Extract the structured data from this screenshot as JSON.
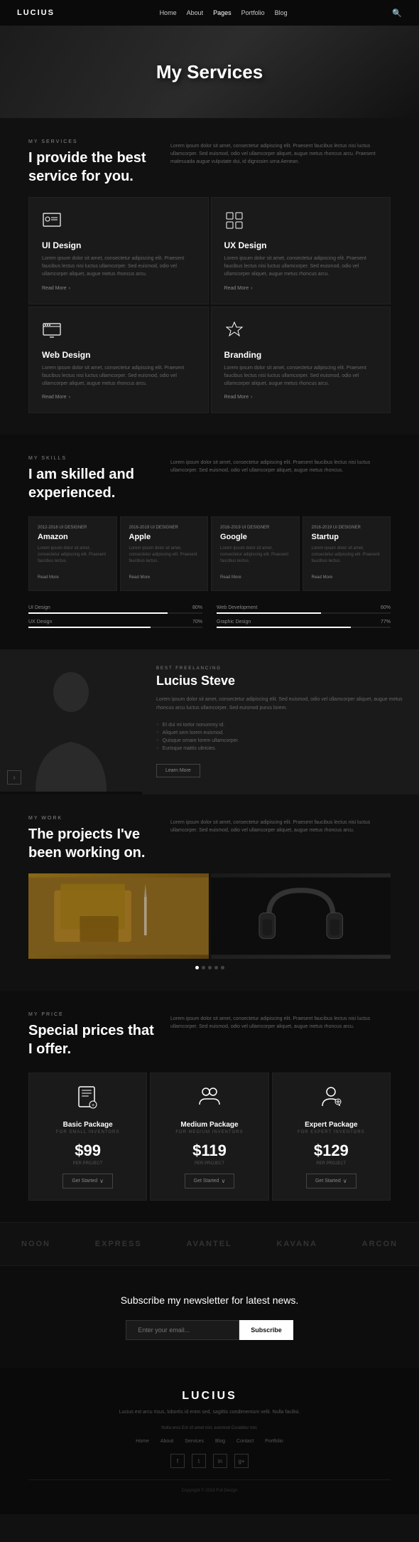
{
  "nav": {
    "logo": "LUCIUS",
    "links": [
      {
        "label": "Home",
        "active": false
      },
      {
        "label": "About",
        "active": false
      },
      {
        "label": "Pages",
        "active": true
      },
      {
        "label": "Portfolio",
        "active": false
      },
      {
        "label": "Blog",
        "active": false
      }
    ]
  },
  "hero": {
    "title": "My Services"
  },
  "services": {
    "section_label": "MY SERVICES",
    "heading": "I provide the best service for you.",
    "description": "Lorem ipsum dolor sit amet, consectetur adipiscing elit. Praesent faucibus lectus nisi luctus ullamcorper. Sed euismod, odio vel ullamcorper aliquet, augue metus rhoncus arcu. Praesent malesuada augue vulputate dui, id dignissim urna Aenean.",
    "cards": [
      {
        "icon": "🔍",
        "title": "UI Design",
        "description": "Lorem ipsum dolor sit amet, consectetur adipiscing elit. Praesent faucibus lectus nisi luctus ullamcorper. Sed euismod, odio vel ullamcorper aliquet, augue metus rhoncus arcu.",
        "link": "Read More"
      },
      {
        "icon": "⊞",
        "title": "UX Design",
        "description": "Lorem ipsum dolor sit amet, consectetur adipiscing elit. Praesent faucibus lectus nisi luctus ullamcorper. Sed euismod, odio vel ullamcorper aliquet, augue metus rhoncus arcu.",
        "link": "Read More"
      },
      {
        "icon": "🖥",
        "title": "Web Design",
        "description": "Lorem ipsum dolor sit amet, consectetur adipiscing elit. Praesent faucibus lectus nisi luctus ullamcorper. Sed euismod, odio vel ullamcorper aliquet, augue metus rhoncus arcu.",
        "link": "Read More"
      },
      {
        "icon": "🏷",
        "title": "Branding",
        "description": "Lorem ipsum dolor sit amet, consectetur adipiscing elit. Praesent faucibus lectus nisi luctus ullamcorper. Sed euismod, odio vel ullamcorper aliquet, augue metus rhoncus arcu.",
        "link": "Read More"
      }
    ]
  },
  "skills": {
    "section_label": "MY SKILLS",
    "heading": "I am skilled and experienced.",
    "description": "Lorem ipsum dolor sit amet, consectetur adipiscing elit. Praesent faucibus lectus nisi luctus ullamcorper. Sed euismod, odio vel ullamcorper aliquet, augue metus rhoncus.",
    "experience_cards": [
      {
        "years": "2012-2016 UI DESIGNER",
        "company": "Amazon",
        "description": "Lorem ipsum dolor sit amet, consectetur adipiscing elit. Praesent faucibus lectus.",
        "link": "Read More"
      },
      {
        "years": "2016-2019 UI DESIGNER",
        "company": "Apple",
        "description": "Lorem ipsum dolor sit amet, consectetur adipiscing elit. Praesent faucibus lectus.",
        "link": "Read More"
      },
      {
        "years": "2016-2019 UI DESIGNER",
        "company": "Google",
        "description": "Lorem ipsum dolor sit amet, consectetur adipiscing elit. Praesent faucibus lectus.",
        "link": "Read More"
      },
      {
        "years": "2016-2019 UI DESIGNER",
        "company": "Startup",
        "description": "Lorem ipsum dolor sit amet, consectetur adipiscing elit. Praesent faucibus lectus.",
        "link": "Read More"
      }
    ],
    "skill_bars": [
      {
        "name": "UI Design",
        "percentage": 80
      },
      {
        "name": "Web Development",
        "percentage": 60
      },
      {
        "name": "UX Design",
        "percentage": 70
      },
      {
        "name": "Graphic Design",
        "percentage": 77
      }
    ]
  },
  "freelancer": {
    "label": "BEST FREELANCING",
    "name": "Lucius Steve",
    "description": "Lorem ipsum dolor sit amet, consectetur adipiscing elit. Sed euismod, odio vel ullamcorper aliquet, augue metus rhoncus arcu luctus ullamcorper. Sed euismod purus lorem.",
    "list": [
      "Et dui mi tortor nonummy id.",
      "Aliquet sem lorem euismod.",
      "Quisque ornare lorem ullamcorper.",
      "Eurisque mattis ultricies."
    ],
    "learn_more": "Learn More"
  },
  "work": {
    "section_label": "MY WORK",
    "heading": "The projects I've been working on.",
    "description": "Lorem ipsum dolor sit amet, consectetur adipiscing elit. Praesent faucibus lectus nisi luctus ullamcorper. Sed euismod, odio vel ullamcorper aliquet, augue metus rhoncus arcu.",
    "portfolio_items": [
      {
        "label": "Wallet"
      },
      {
        "label": "Headphones"
      }
    ]
  },
  "pricing": {
    "section_label": "MY PRICE",
    "heading": "Special prices that I offer.",
    "description": "Lorem ipsum dolor sit amet, consectetur adipiscing elit. Praesent faucibus lectus nisi luctus ullamcorper. Sed euismod, odio vel ullamcorper aliquet, augue metus rhoncus arcu.",
    "plans": [
      {
        "icon": "📄",
        "name": "Basic Package",
        "sub": "For Small Inventors",
        "price": "$99",
        "period": "Per Project",
        "button": "Get Started"
      },
      {
        "icon": "👥",
        "name": "Medium Package",
        "sub": "For Medium Inventors",
        "price": "$119",
        "period": "Per Project",
        "button": "Get Started"
      },
      {
        "icon": "👤",
        "name": "Expert Package",
        "sub": "For Expert Inventors",
        "price": "$129",
        "period": "Per Project",
        "button": "Get Started"
      }
    ]
  },
  "brands": [
    "NOON",
    "EXPRESS",
    "AVANTEL",
    "KAVANA",
    "ARCON"
  ],
  "newsletter": {
    "title": "Subscribe my newsletter for latest news.",
    "placeholder": "Enter your email...",
    "button": "Subscribe"
  },
  "footer": {
    "logo": "LUCIUS",
    "tagline": "Lucius est arcu risus, lobortis id enim sed, sagittis\ncondimentum velit. Nulla facilisi.",
    "address": "Nulla eros Est sit amet nisl, euismod Curabitur nisl.",
    "nav_links": [
      "Home",
      "About",
      "Services",
      "Blog",
      "Contact",
      "Portfolio"
    ],
    "social_icons": [
      "f",
      "t",
      "in",
      "g"
    ],
    "copyright": "Copyright © 2019 Full Design"
  }
}
